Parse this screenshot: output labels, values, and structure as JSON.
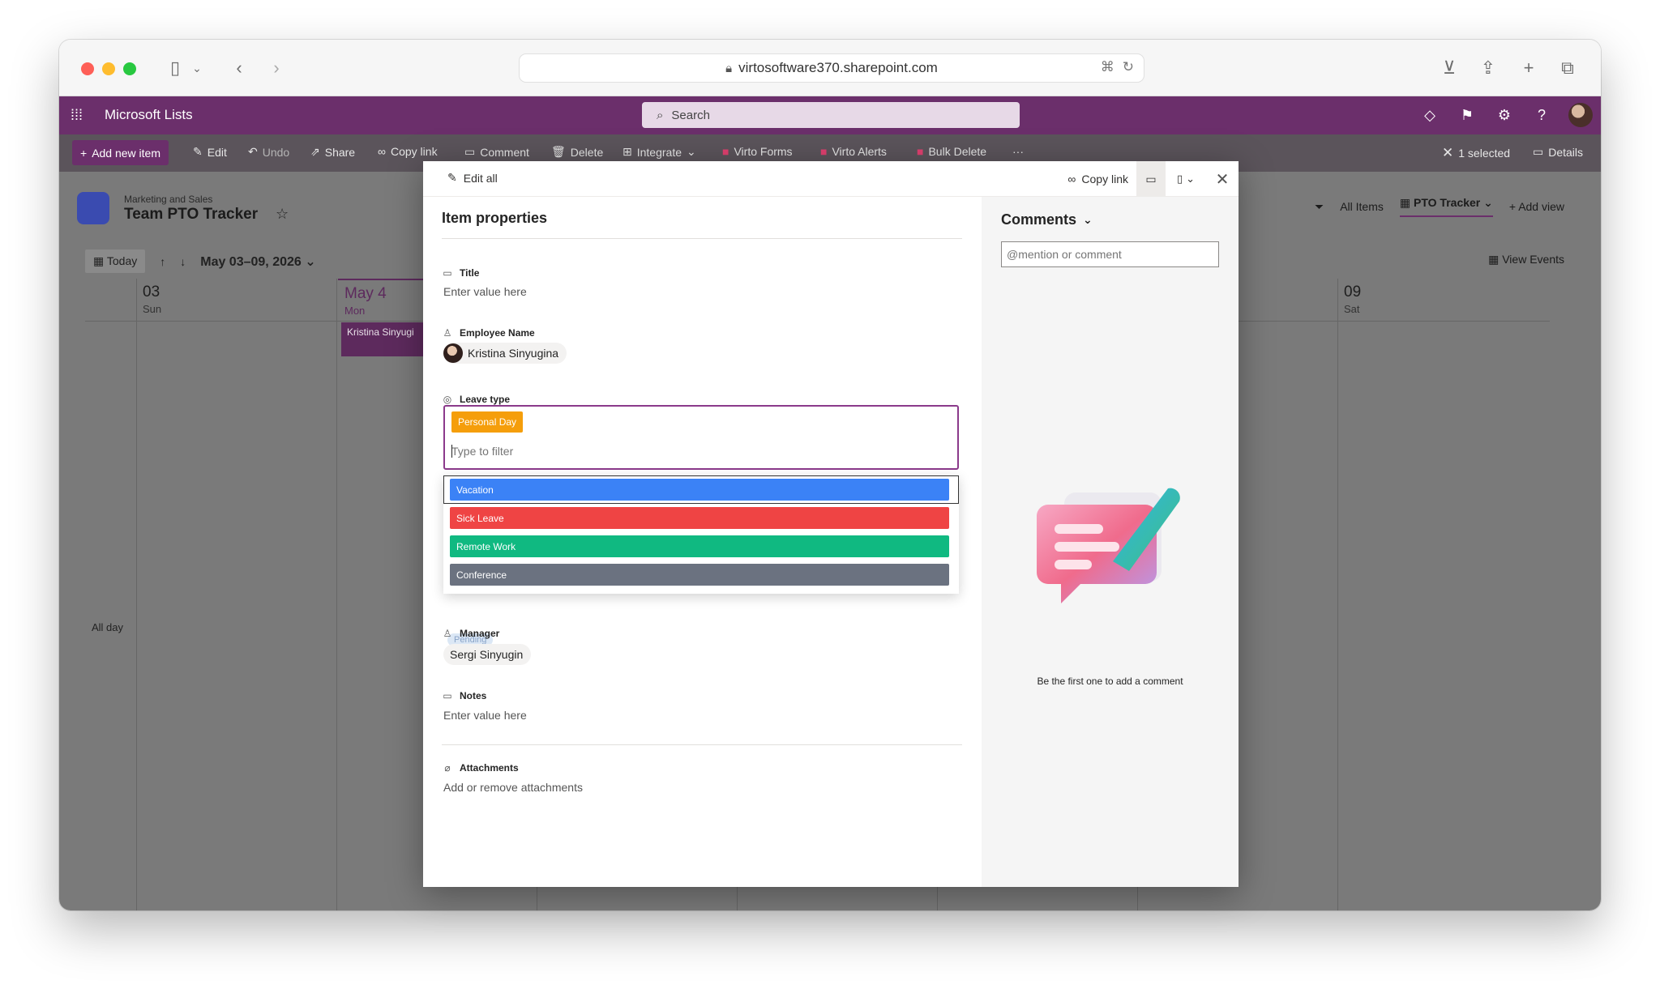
{
  "browser": {
    "url": "virtosoftware370.sharepoint.com"
  },
  "suite": {
    "app_name": "Microsoft Lists",
    "search_placeholder": "Search"
  },
  "command_bar": {
    "add_new_item": "Add new item",
    "edit": "Edit",
    "undo": "Undo",
    "share": "Share",
    "copy_link": "Copy link",
    "comment": "Comment",
    "delete": "Delete",
    "integrate": "Integrate",
    "virto_forms": "Virto Forms",
    "virto_alerts": "Virto Alerts",
    "bulk_delete": "Bulk Delete",
    "more": "···",
    "selected": "1 selected",
    "details": "Details"
  },
  "list": {
    "site": "Marketing and Sales",
    "title": "Team PTO Tracker"
  },
  "views": {
    "all_items": "All Items",
    "current": "PTO Tracker",
    "add_view": "Add view"
  },
  "calendar": {
    "today": "Today",
    "range": "May 03–09, 2026",
    "view_events": "View Events",
    "all_day": "All day",
    "days": [
      {
        "num": "03",
        "name": "Sun"
      },
      {
        "num": "May 4",
        "name": "Mon"
      },
      {
        "num": "09",
        "name": "Sat"
      }
    ],
    "event": "Kristina Sinyugi"
  },
  "modal": {
    "edit_all": "Edit all",
    "copy_link": "Copy link",
    "pane_title": "Item properties",
    "fields": {
      "title_label": "Title",
      "title_value": "Enter value here",
      "employee_label": "Employee Name",
      "employee_value": "Kristina Sinyugina",
      "leave_label": "Leave type",
      "leave_selected": "Personal Day",
      "filter_placeholder": "Type to filter",
      "status_ghost": "Pending",
      "manager_label": "Manager",
      "manager_value": "Sergi Sinyugin",
      "notes_label": "Notes",
      "notes_value": "Enter value here",
      "attachments_label": "Attachments",
      "attachments_value": "Add or remove attachments"
    },
    "options": [
      {
        "label": "Vacation",
        "color": "#3b82f6"
      },
      {
        "label": "Sick Leave",
        "color": "#ef4444"
      },
      {
        "label": "Remote Work",
        "color": "#10b981"
      },
      {
        "label": "Conference",
        "color": "#6b7280"
      }
    ],
    "comments": {
      "title": "Comments",
      "placeholder": "@mention or comment",
      "empty": "Be the first one to add a comment"
    }
  },
  "colors": {
    "brand": "#6b2f6b",
    "personal_day": "#f59e0b"
  }
}
